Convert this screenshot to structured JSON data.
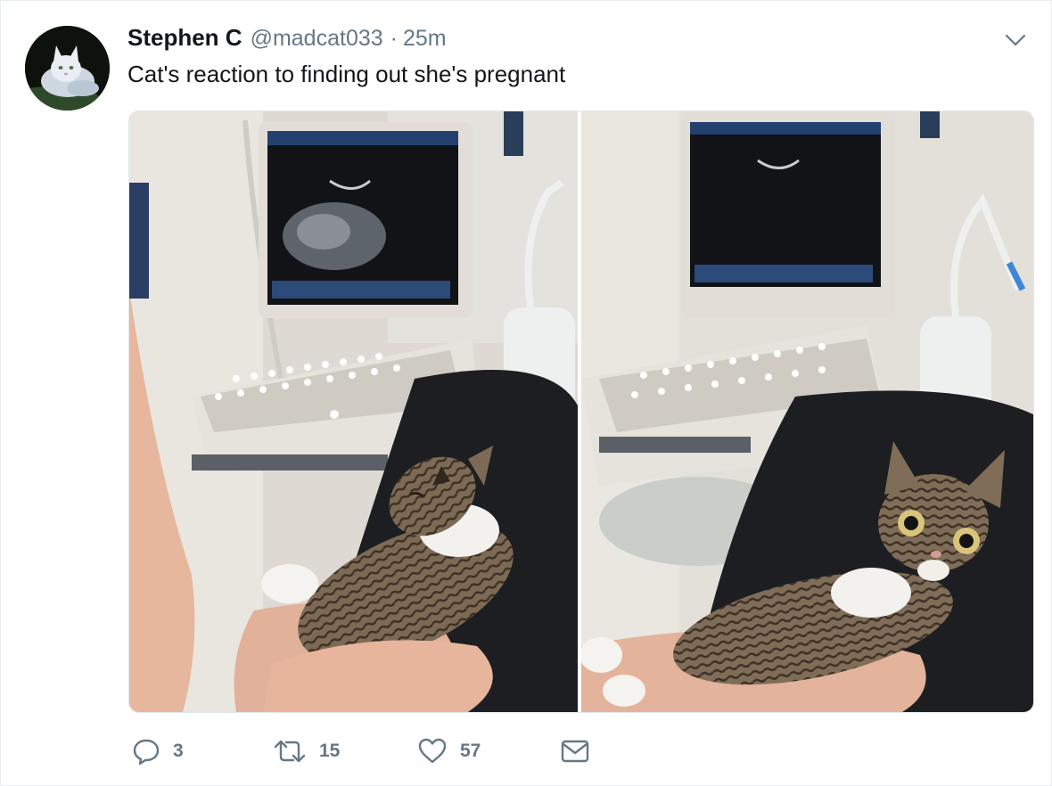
{
  "tweet": {
    "author_name": "Stephen C",
    "author_handle": "@madcat033",
    "separator": "·",
    "timestamp": "25m",
    "text": "Cat's reaction to finding out she's pregnant",
    "media": [
      {
        "icon": "photo-cat-calm"
      },
      {
        "icon": "photo-cat-shocked"
      }
    ]
  },
  "actions": {
    "reply_count": "3",
    "retweet_count": "15",
    "like_count": "57",
    "icons": [
      "reply-icon",
      "retweet-icon",
      "like-icon",
      "direct-message-icon"
    ]
  },
  "colors": {
    "text_primary": "#14171a",
    "text_secondary": "#657786",
    "border": "#e6ecf0"
  }
}
